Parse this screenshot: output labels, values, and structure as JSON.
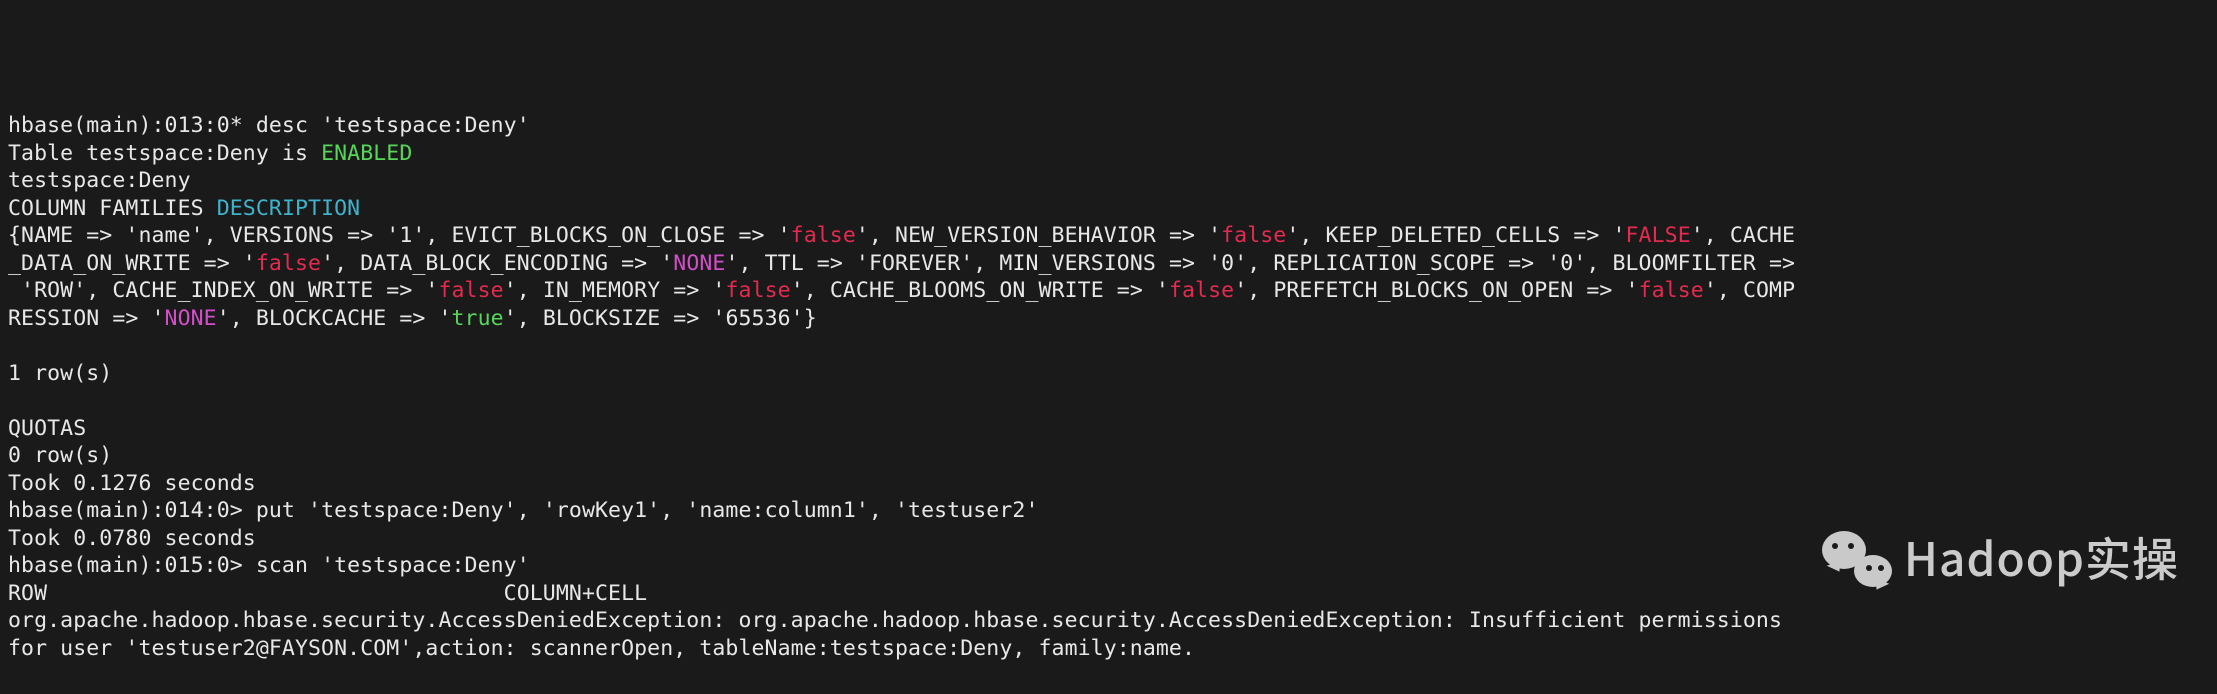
{
  "watermark": {
    "text": "Hadoop实操"
  },
  "prompts": {
    "p013": "hbase(main):013:0* ",
    "p014": "hbase(main):014:0> ",
    "p015": "hbase(main):015:0> "
  },
  "cmd": {
    "desc": "desc 'testspace:Deny'",
    "put": "put 'testspace:Deny', 'rowKey1', 'name:column1', 'testuser2'",
    "scan": "scan 'testspace:Deny'"
  },
  "desc_out": {
    "l1a": "Table testspace:Deny is ",
    "l1b": "ENABLED",
    "l2": "testspace:Deny",
    "l3a": "COLUMN FAMILIES ",
    "l3b": "DESCRIPTION",
    "s1": "{NAME => 'name', VERSIONS => '1', EVICT_BLOCKS_ON_CLOSE => '",
    "v1": "false",
    "s2": "', NEW_VERSION_BEHAVIOR => '",
    "v2": "false",
    "s3": "', KEEP_DELETED_CELLS => '",
    "v3": "FALSE",
    "s4": "', CACHE",
    "s5": "_DATA_ON_WRITE => '",
    "v4": "false",
    "s6": "', DATA_BLOCK_ENCODING => '",
    "v5": "NONE",
    "s7": "', TTL => 'FOREVER', MIN_VERSIONS => '0', REPLICATION_SCOPE => '0', BLOOMFILTER =>",
    "s8": " 'ROW', CACHE_INDEX_ON_WRITE => '",
    "v6": "false",
    "s9": "', IN_MEMORY => '",
    "v7": "false",
    "s10": "', CACHE_BLOOMS_ON_WRITE => '",
    "v8": "false",
    "s11": "', PREFETCH_BLOCKS_ON_OPEN => '",
    "v9": "false",
    "s12": "', COMP",
    "s13": "RESSION => '",
    "v10": "NONE",
    "s14": "', BLOCKCACHE => '",
    "v11": "true",
    "s15": "', BLOCKSIZE => '65536'}",
    "blank": "",
    "rows1": "1 row(s)",
    "quotas": "QUOTAS",
    "rows0": "0 row(s)",
    "took1": "Took 0.1276 seconds"
  },
  "put_out": {
    "took": "Took 0.0780 seconds"
  },
  "scan_out": {
    "header": "ROW                                   COLUMN+CELL",
    "err1": "org.apache.hadoop.hbase.security.AccessDeniedException: org.apache.hadoop.hbase.security.AccessDeniedException: Insufficient permissions",
    "err2": "for user 'testuser2@FAYSON.COM',action: scannerOpen, tableName:testspace:Deny, family:name."
  }
}
